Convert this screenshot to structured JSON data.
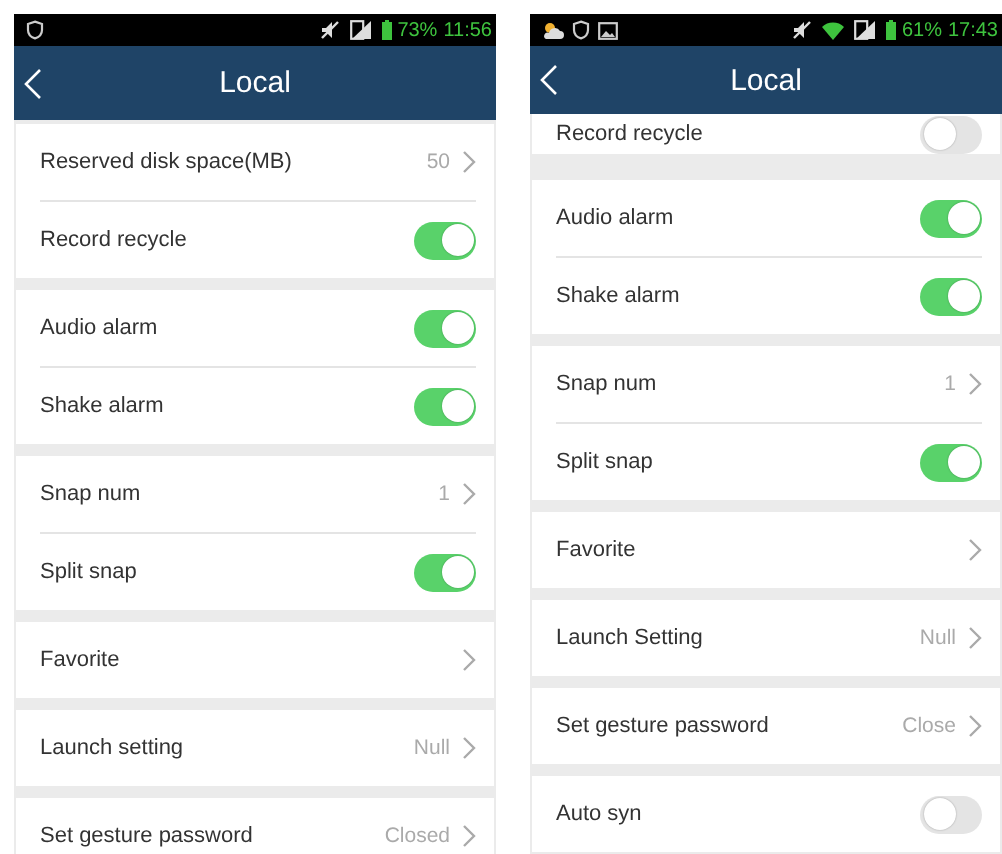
{
  "phones": [
    {
      "status_bar": {
        "battery": "73%",
        "time": "11:56"
      },
      "header": {
        "title": "Local"
      },
      "groups": [
        {
          "rows": [
            {
              "kind": "value",
              "label": "Reserved disk space(MB)",
              "value": "50"
            },
            {
              "kind": "toggle",
              "label": "Record recycle",
              "on": true
            }
          ]
        },
        {
          "rows": [
            {
              "kind": "toggle",
              "label": "Audio alarm",
              "on": true
            },
            {
              "kind": "toggle",
              "label": "Shake alarm",
              "on": true
            }
          ]
        },
        {
          "rows": [
            {
              "kind": "value",
              "label": "Snap num",
              "value": "1"
            },
            {
              "kind": "toggle",
              "label": "Split snap",
              "on": true
            }
          ]
        },
        {
          "rows": [
            {
              "kind": "link",
              "label": "Favorite"
            }
          ]
        },
        {
          "rows": [
            {
              "kind": "value",
              "label": "Launch setting",
              "value": "Null"
            }
          ]
        },
        {
          "rows": [
            {
              "kind": "value",
              "label": "Set gesture password",
              "value": "Closed"
            }
          ]
        }
      ]
    },
    {
      "status_bar": {
        "battery": "61%",
        "time": "17:43"
      },
      "header": {
        "title": "Local"
      },
      "groups": [
        {
          "rows": [
            {
              "kind": "toggle",
              "label": "Record recycle",
              "on": false
            }
          ]
        },
        {
          "rows": [
            {
              "kind": "toggle",
              "label": "Audio alarm",
              "on": true
            },
            {
              "kind": "toggle",
              "label": "Shake alarm",
              "on": true
            }
          ]
        },
        {
          "rows": [
            {
              "kind": "value",
              "label": "Snap num",
              "value": "1"
            },
            {
              "kind": "toggle",
              "label": "Split snap",
              "on": true
            }
          ]
        },
        {
          "rows": [
            {
              "kind": "link",
              "label": "Favorite"
            }
          ]
        },
        {
          "rows": [
            {
              "kind": "value",
              "label": "Launch Setting",
              "value": "Null"
            }
          ]
        },
        {
          "rows": [
            {
              "kind": "value",
              "label": "Set gesture password",
              "value": "Close"
            }
          ]
        },
        {
          "rows": [
            {
              "kind": "toggle",
              "label": "Auto syn",
              "on": false
            }
          ]
        }
      ]
    }
  ]
}
